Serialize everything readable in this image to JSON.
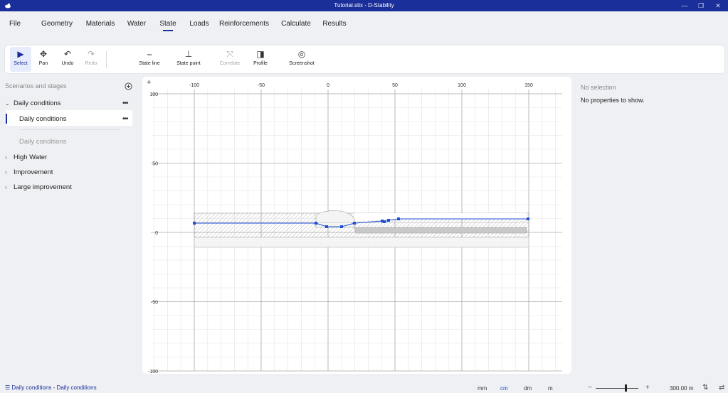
{
  "window": {
    "title": "Tutorial.stix - D-Stability",
    "minimize": "—",
    "restore": "❐",
    "close": "✕"
  },
  "menu": {
    "items": [
      "File",
      "Geometry",
      "Materials",
      "Water",
      "State",
      "Loads",
      "Reinforcements",
      "Calculate",
      "Results"
    ],
    "active": "State"
  },
  "ribbon": {
    "select": {
      "label": "Select",
      "icon": "cursor-arrow-icon"
    },
    "pan": {
      "label": "Pan",
      "icon": "pan-arrows-icon"
    },
    "undo": {
      "label": "Undo",
      "icon": "undo-icon"
    },
    "redo": {
      "label": "Redo",
      "icon": "redo-icon"
    },
    "state_line": {
      "label": "State line",
      "icon": "state-line-icon"
    },
    "state_point": {
      "label": "State point",
      "icon": "state-point-icon"
    },
    "correlate": {
      "label": "Correlate",
      "icon": "correlate-icon"
    },
    "profile": {
      "label": "Profile",
      "icon": "profile-icon"
    },
    "screenshot": {
      "label": "Screenshot",
      "icon": "camera-icon"
    }
  },
  "left_panel": {
    "header": "Scenarios and stages",
    "scenario_daily": "Daily conditions",
    "stage_daily": "Daily conditions",
    "stage_faded": "Daily conditions",
    "scenario_high_water": "High Water",
    "scenario_improvement": "Improvement",
    "scenario_large_improvement": "Large improvement",
    "more": "•••",
    "chev_open": "⌄",
    "chev_closed": "›"
  },
  "canvas": {
    "x_ticks": [
      "-100",
      "-50",
      "0",
      "50",
      "100",
      "150"
    ],
    "y_ticks": [
      "100",
      "50",
      "0",
      "-50",
      "-100"
    ],
    "plus": "+",
    "colors": {
      "state_line": "#1f4fd6",
      "grid": "#e2e2e2",
      "major_grid": "#9a9a9a"
    }
  },
  "right_panel": {
    "title": "No selection",
    "message": "No properties to show."
  },
  "status": {
    "breadcrumb": "Daily conditions - Daily conditions",
    "units": [
      "mm",
      "cm",
      "dm",
      "m"
    ],
    "active_unit": "cm",
    "zoom_minus": "−",
    "zoom_plus": "+",
    "zoom_value": "300.00 m",
    "sort_icon": "⇅",
    "swap_icon": "⇄",
    "list_icon": "☰"
  }
}
